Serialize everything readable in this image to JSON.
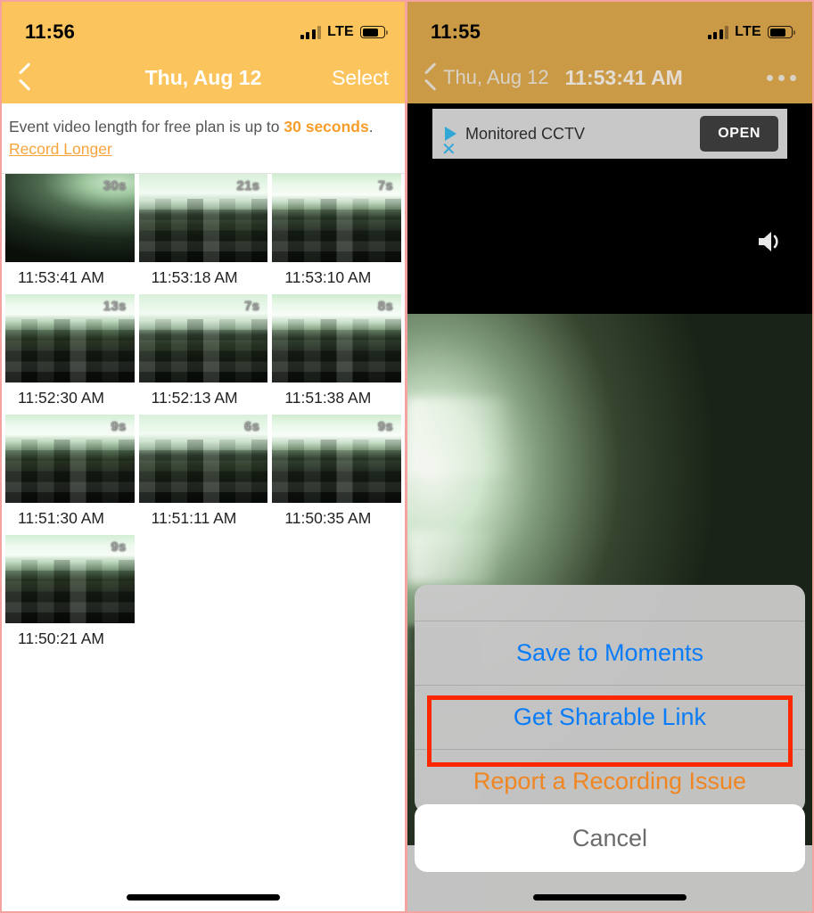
{
  "left_panel": {
    "status_bar": {
      "time": "11:56",
      "network": "LTE",
      "signal_bars": 3,
      "battery_level": "74"
    },
    "nav": {
      "back_icon": "chevron-left-icon",
      "title": "Thu, Aug 12",
      "action_label": "Select"
    },
    "notice": {
      "text_before": "Event video length for free plan is up to ",
      "highlight": "30 seconds",
      "text_after": ".",
      "link_label": "Record Longer",
      "highlight_color": "#f79d2b"
    },
    "events": [
      {
        "duration": "30s",
        "time": "11:53:41 AM",
        "scene": "scene-dark",
        "pixelated": false
      },
      {
        "duration": "21s",
        "time": "11:53:18 AM",
        "scene": "scene-room",
        "pixelated": true
      },
      {
        "duration": "7s",
        "time": "11:53:10 AM",
        "scene": "scene-room2",
        "pixelated": true
      },
      {
        "duration": "13s",
        "time": "11:52:30 AM",
        "scene": "scene-room3",
        "pixelated": true
      },
      {
        "duration": "7s",
        "time": "11:52:13 AM",
        "scene": "scene-room",
        "pixelated": true
      },
      {
        "duration": "8s",
        "time": "11:51:38 AM",
        "scene": "scene-room2",
        "pixelated": true
      },
      {
        "duration": "9s",
        "time": "11:51:30 AM",
        "scene": "scene-room3",
        "pixelated": true
      },
      {
        "duration": "6s",
        "time": "11:51:11 AM",
        "scene": "scene-room",
        "pixelated": true
      },
      {
        "duration": "9s",
        "time": "11:50:35 AM",
        "scene": "scene-room2",
        "pixelated": true
      },
      {
        "duration": "9s",
        "time": "11:50:21 AM",
        "scene": "scene-room3",
        "pixelated": true
      }
    ],
    "header_color": "#fbc45c"
  },
  "right_panel": {
    "status_bar": {
      "time": "11:55",
      "network": "LTE",
      "signal_bars": 3,
      "battery_level": "74"
    },
    "nav": {
      "back_icon": "chevron-left-icon",
      "back_label": "Thu, Aug 12",
      "title": "11:53:41 AM",
      "more_icon": "more-horizontal-icon"
    },
    "ad": {
      "play_icon": "play-triangle-icon",
      "label": "Monitored CCTV",
      "close_icon": "close-icon",
      "button_label": "OPEN",
      "accent_color": "#2fa8d6"
    },
    "player": {
      "speaker_icon": "speaker-volume-icon"
    },
    "action_sheet": {
      "items": [
        {
          "label": "Save to Moments",
          "style": "blue",
          "highlighted": true
        },
        {
          "label": "Get Sharable Link",
          "style": "blue",
          "highlighted": false
        },
        {
          "label": "Report a Recording Issue",
          "style": "orange",
          "highlighted": false
        }
      ],
      "cancel_label": "Cancel",
      "highlight_color": "#fb2800"
    },
    "header_color": "#ca9a47"
  }
}
